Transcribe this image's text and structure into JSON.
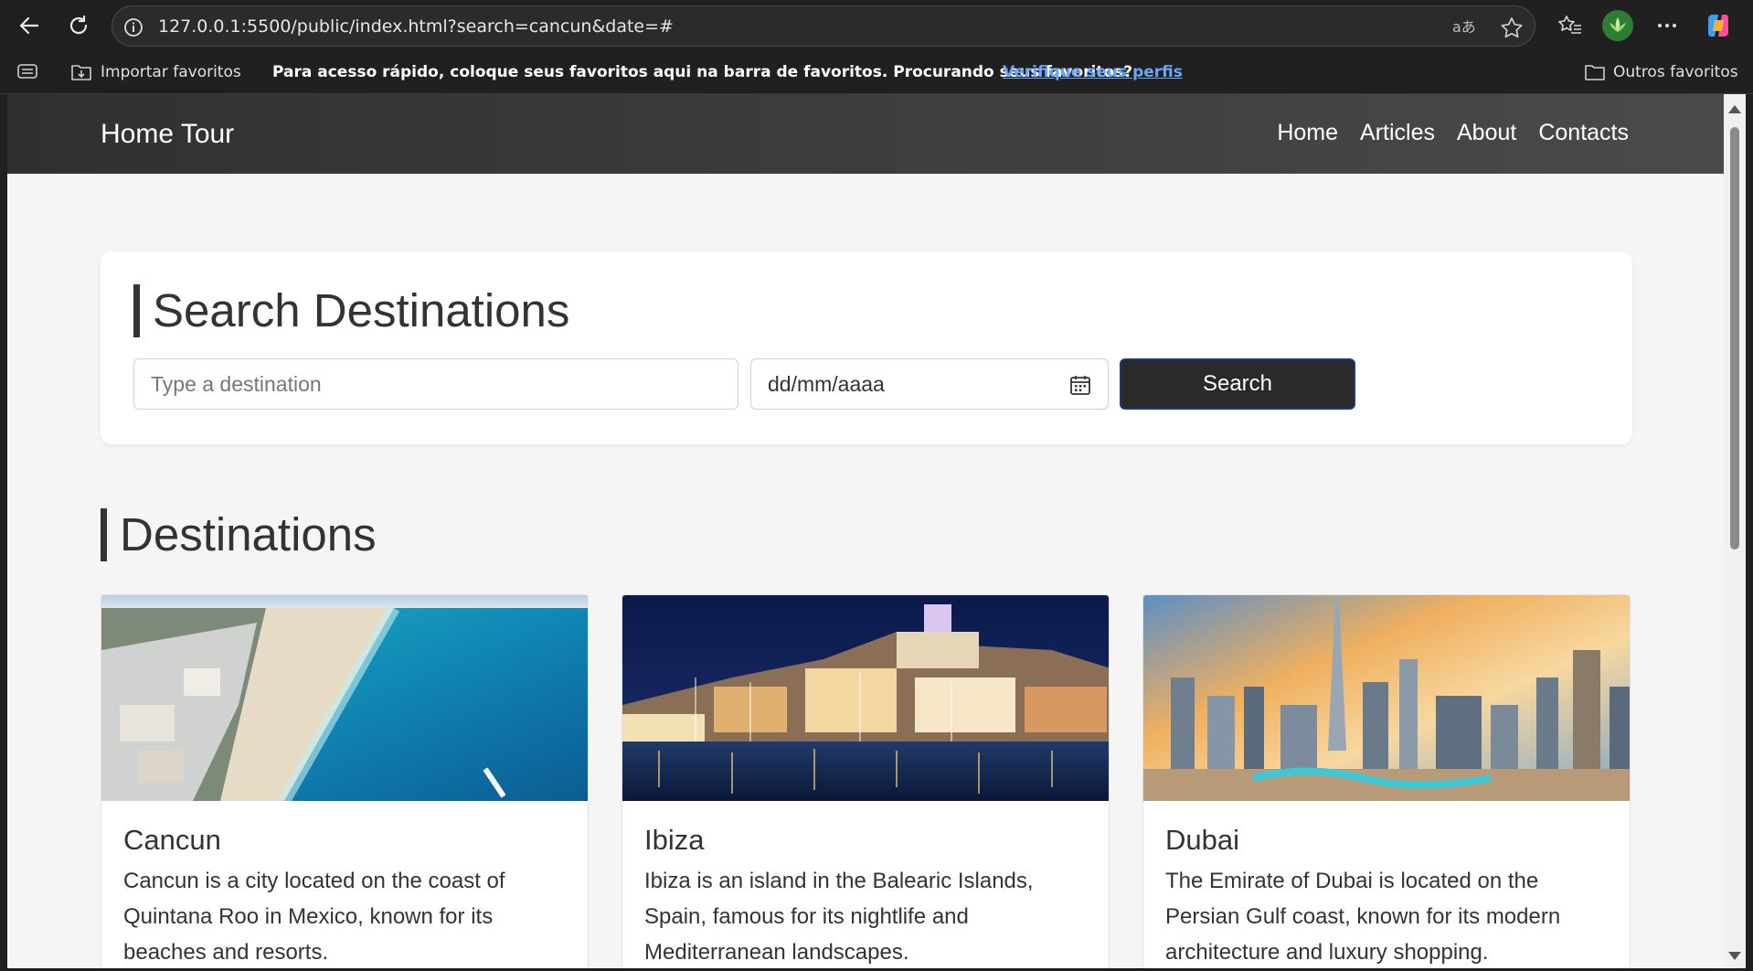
{
  "browser": {
    "url": "127.0.0.1:5500/public/index.html?search=cancun&date=#",
    "favorites_bar": {
      "import_label": "Importar favoritos",
      "message": "Para acesso rápido, coloque seus favoritos aqui na barra de favoritos. Procurando seus favoritos?",
      "link": "Verifique seus perfis",
      "other_label": "Outros favoritos"
    }
  },
  "header": {
    "brand": "Home Tour",
    "nav": [
      "Home",
      "Articles",
      "About",
      "Contacts"
    ]
  },
  "search": {
    "title": "Search Destinations",
    "destination_placeholder": "Type a destination",
    "date_value": "dd/mm/aaaa",
    "button_label": "Search"
  },
  "destinations": {
    "title": "Destinations",
    "cards": [
      {
        "name": "Cancun",
        "description": "Cancun is a city located on the coast of Quintana Roo in Mexico, known for its beaches and resorts.",
        "image": "cancun-aerial-beach-photo"
      },
      {
        "name": "Ibiza",
        "description": "Ibiza is an island in the Balearic Islands, Spain, famous for its nightlife and Mediterranean landscapes.",
        "image": "ibiza-harbor-night-photo"
      },
      {
        "name": "Dubai",
        "description": "The Emirate of Dubai is located on the Persian Gulf coast, known for its modern architecture and luxury shopping.",
        "image": "dubai-skyline-sunset-photo"
      }
    ]
  }
}
